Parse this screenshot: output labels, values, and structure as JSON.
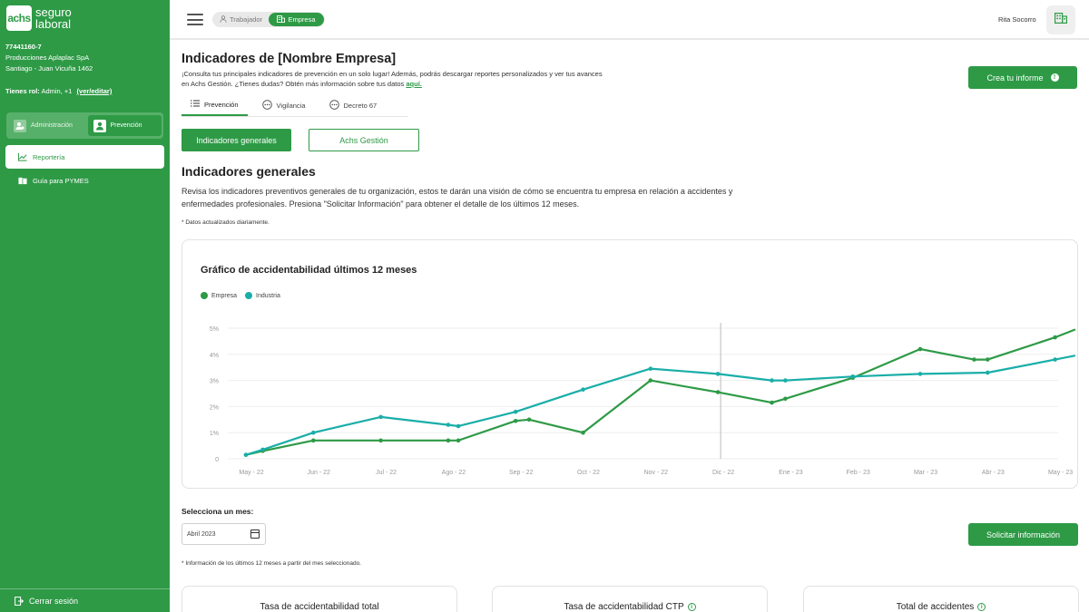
{
  "sidebar": {
    "logo_mark": "achs",
    "logo_line1": "seguro",
    "logo_line2": "laboral",
    "rut": "77441160-7",
    "company": "Producciones Aplaplac SpA",
    "address": "Santiago - Juan Vicuña 1462",
    "rol_prefix": "Tienes rol:",
    "rol_value": "Admin, +1",
    "rol_link": "(ver/editar)",
    "roles": [
      {
        "label": "Administración",
        "active": false
      },
      {
        "label": "Prevención",
        "active": true
      }
    ],
    "nav": [
      {
        "label": "Reportería",
        "active": true
      },
      {
        "label": "Guía para PYMES",
        "active": false
      }
    ],
    "logout": "Cerrar sesión"
  },
  "topbar": {
    "views": [
      {
        "label": "Trabajador",
        "active": false
      },
      {
        "label": "Empresa",
        "active": true
      }
    ],
    "user_name": "Rita Socorro"
  },
  "main": {
    "title": "Indicadores de [Nombre Empresa]",
    "desc_line1": "¡Consulta tus principales indicadores de prevención en un solo lugar! Además, podrás descargar reportes personalizados y ver tus avances",
    "desc_line2": "en Achs Gestión. ¿Tienes dudas? Obtén más información sobre tus datos",
    "desc_link": "aquí.",
    "report_button": "Crea tu informe",
    "tabs": [
      {
        "label": "Prevención",
        "active": true
      },
      {
        "label": "Vigilancia",
        "active": false
      },
      {
        "label": "Decreto 67",
        "active": false
      }
    ],
    "btn_indicadores": "Indicadores generales",
    "btn_gestion": "Achs Gestión",
    "section_title": "Indicadores generales",
    "section_desc": "Revisa los indicadores preventivos generales de tu organización, estos te darán una visión de cómo se encuentra tu empresa en relación a accidentes y enfermedades profesionales. Presiona \"Solicitar Información\" para obtener el detalle de los últimos 12 meses.",
    "note_daily": "* Datos actualizados diariamente.",
    "month_label": "Selecciona un mes:",
    "month_value": "Abril 2023",
    "solicitar_button": "Solicitar información",
    "note_months": "* Información de los últimos 12 meses a partir del mes seleccionado.",
    "stat_cards": [
      {
        "title": "Tasa de accidentabilidad total",
        "info": false
      },
      {
        "title": "Tasa de accidentabilidad CTP",
        "info": true
      },
      {
        "title": "Total de accidentes",
        "info": true
      }
    ]
  },
  "colors": {
    "brand": "#2e9a46",
    "empresa": "#2e9a46",
    "industria": "#1aaea8"
  },
  "chart_data": {
    "type": "line",
    "title": "Gráfico de accidentabilidad últimos 12 meses",
    "categories": [
      "May - 22",
      "Jun - 22",
      "Jul - 22",
      "Ago - 22",
      "Sep - 22",
      "Oct - 22",
      "Nov - 22",
      "Dic - 22",
      "Ene - 23",
      "Feb - 23",
      "Mar - 23",
      "Abr - 23",
      "May - 23"
    ],
    "yticks": [
      "0",
      "1%",
      "2%",
      "3%",
      "4%",
      "5%"
    ],
    "ylim": [
      0,
      5
    ],
    "series": [
      {
        "name": "Empresa",
        "color": "#2e9a46",
        "points": [
          [
            0,
            0.15
          ],
          [
            0.25,
            0.3
          ],
          [
            1,
            0.7
          ],
          [
            2,
            0.7
          ],
          [
            3,
            0.7
          ],
          [
            3.15,
            0.7
          ],
          [
            4,
            1.45
          ],
          [
            4.2,
            1.5
          ],
          [
            5,
            1.0
          ],
          [
            6,
            3.0
          ],
          [
            7,
            2.55
          ],
          [
            7.8,
            2.15
          ],
          [
            8,
            2.3
          ],
          [
            9,
            3.1
          ],
          [
            10,
            4.2
          ],
          [
            10.8,
            3.8
          ],
          [
            11,
            3.8
          ],
          [
            12,
            4.65
          ],
          [
            12.3,
            4.95
          ]
        ]
      },
      {
        "name": "Industria",
        "color": "#1aaea8",
        "points": [
          [
            0,
            0.15
          ],
          [
            0.25,
            0.35
          ],
          [
            1,
            1.0
          ],
          [
            2,
            1.6
          ],
          [
            3,
            1.3
          ],
          [
            3.15,
            1.25
          ],
          [
            4,
            1.8
          ],
          [
            5,
            2.65
          ],
          [
            6,
            3.45
          ],
          [
            7,
            3.25
          ],
          [
            7.8,
            3.0
          ],
          [
            8,
            3.0
          ],
          [
            9,
            3.15
          ],
          [
            10,
            3.25
          ],
          [
            11,
            3.3
          ],
          [
            12,
            3.8
          ],
          [
            12.3,
            3.95
          ]
        ]
      }
    ],
    "highlight_category": "Dic - 22",
    "grid": true,
    "legend": "top-left"
  }
}
